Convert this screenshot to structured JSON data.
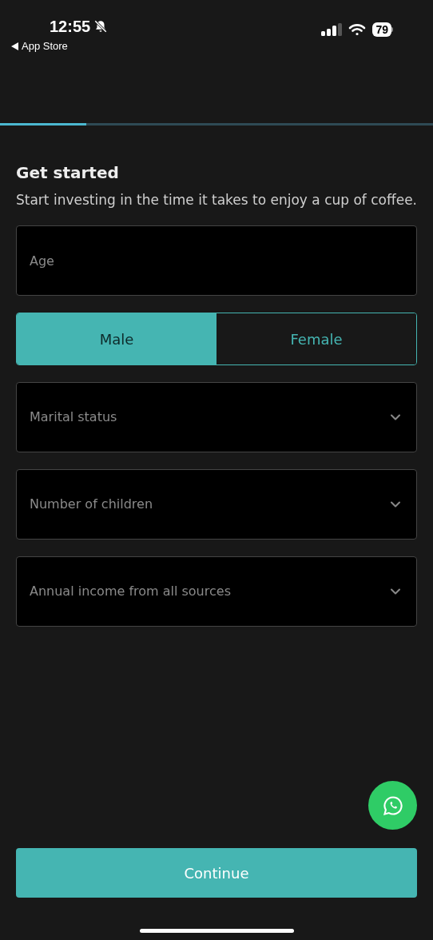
{
  "status_bar": {
    "time": "12:55",
    "back_label": "App Store",
    "battery": "79"
  },
  "progress": {
    "level": 0.2
  },
  "title": "Get started",
  "subtitle": "Start investing in the time it takes to enjoy a cup of coffee.",
  "age_field": {
    "placeholder": "Age"
  },
  "gender": [
    {
      "label": "Male",
      "selected": true
    },
    {
      "label": "Female",
      "selected": false
    }
  ],
  "dropdowns": [
    {
      "placeholder": "Marital status"
    },
    {
      "placeholder": "Number of children"
    },
    {
      "placeholder": "Annual income from all sources"
    }
  ],
  "continue_button": "Continue"
}
